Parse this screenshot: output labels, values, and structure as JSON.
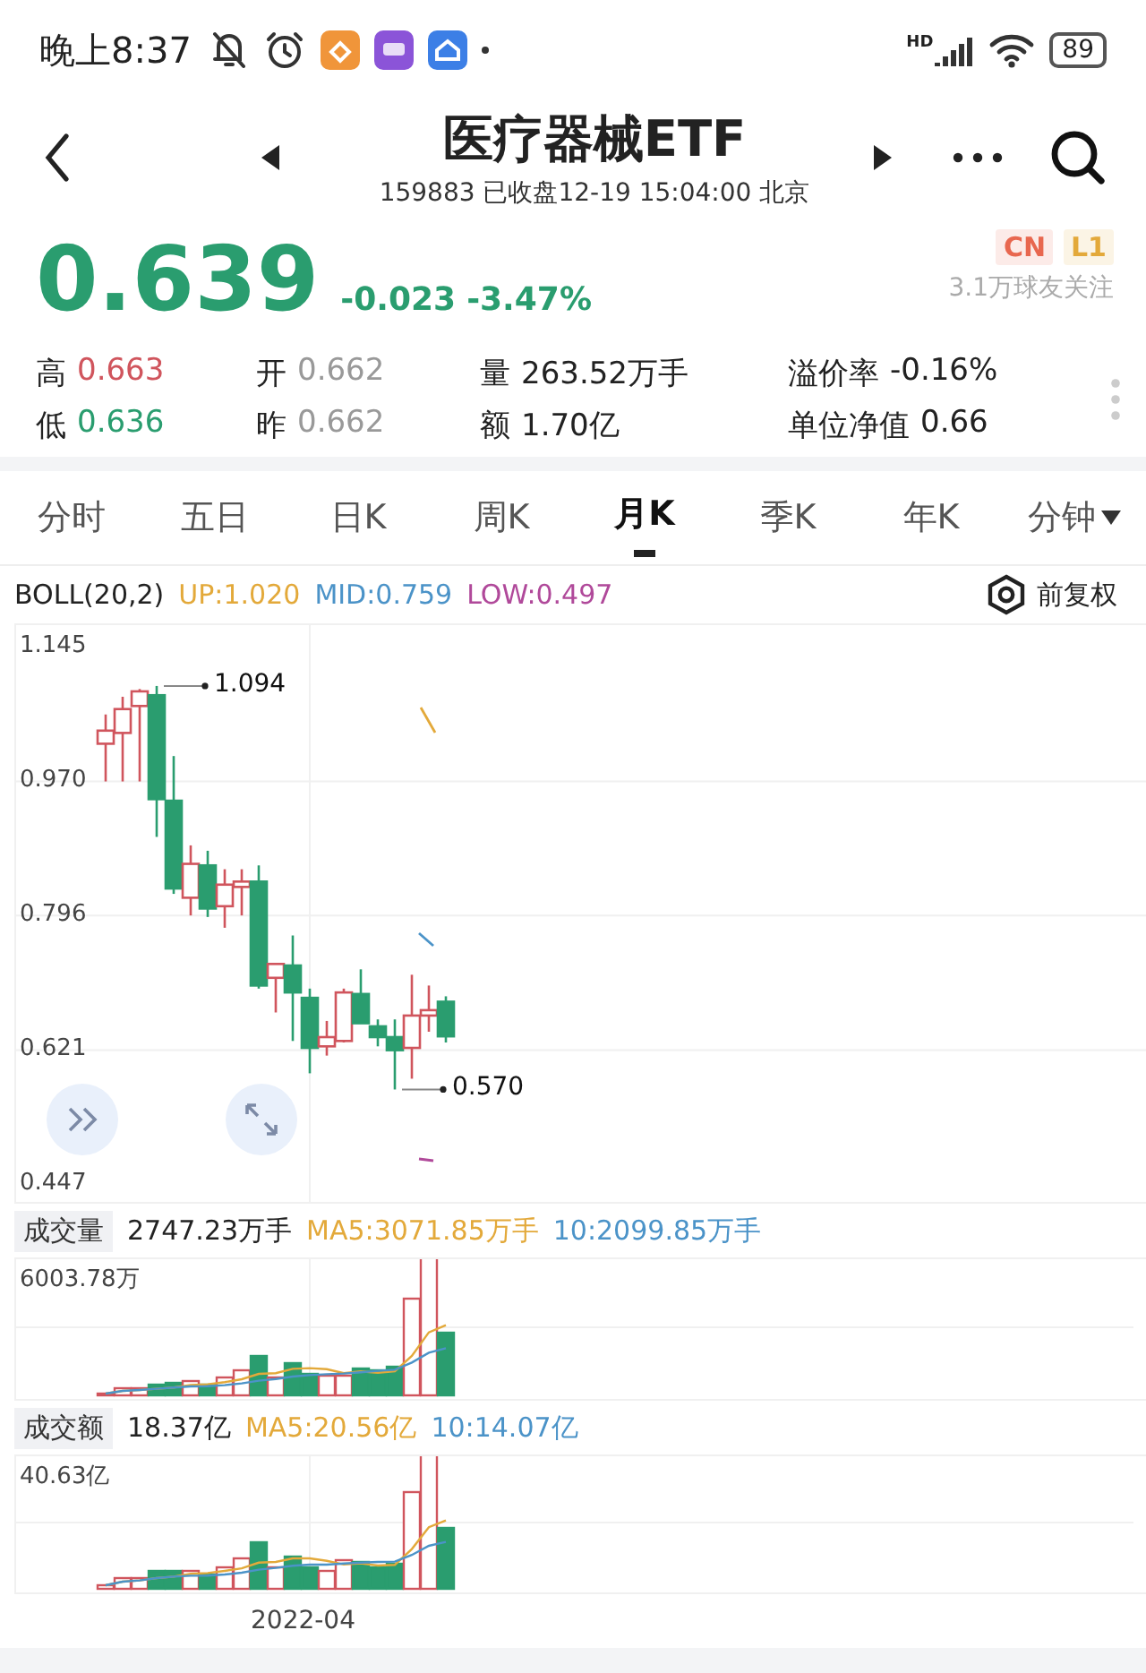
{
  "status_bar": {
    "time": "晚上8:37",
    "network": "HD",
    "battery": "89"
  },
  "header": {
    "title": "医疗器械ETF",
    "subtitle": "159883 已收盘12-19 15:04:00 北京"
  },
  "quote": {
    "price": "0.639",
    "change": "-0.023",
    "change_pct": "-3.47%",
    "kind": "down",
    "followers": "3.1万球友关注",
    "badges": [
      {
        "label": "CN",
        "color": "#e8674f"
      },
      {
        "label": "L1",
        "color": "#e3a93a"
      }
    ]
  },
  "stats": [
    {
      "label": "高",
      "value": "0.663",
      "kind": "up"
    },
    {
      "label": "开",
      "value": "0.662",
      "kind": "flat"
    },
    {
      "label": "量",
      "value": "263.52万手",
      "kind": "plain"
    },
    {
      "label": "溢价率",
      "value": "-0.16%",
      "kind": "plain"
    },
    {
      "label": "低",
      "value": "0.636",
      "kind": "down"
    },
    {
      "label": "昨",
      "value": "0.662",
      "kind": "flat"
    },
    {
      "label": "额",
      "value": "1.70亿",
      "kind": "plain"
    },
    {
      "label": "单位净值",
      "value": "0.66",
      "kind": "plain"
    }
  ],
  "tabs": [
    {
      "label": "分时",
      "selected": false,
      "dropdown": false
    },
    {
      "label": "五日",
      "selected": false,
      "dropdown": false
    },
    {
      "label": "日K",
      "selected": false,
      "dropdown": false
    },
    {
      "label": "周K",
      "selected": false,
      "dropdown": false
    },
    {
      "label": "月K",
      "selected": true,
      "dropdown": false
    },
    {
      "label": "季K",
      "selected": false,
      "dropdown": false
    },
    {
      "label": "年K",
      "selected": false,
      "dropdown": false
    },
    {
      "label": "分钟",
      "selected": false,
      "dropdown": true
    }
  ],
  "indicator": {
    "name": "BOLL(20,2)",
    "adjust": "前复权",
    "values": [
      {
        "text": "UP:1.020",
        "color": "#e3a93a"
      },
      {
        "text": "MID:0.759",
        "color": "#4b93c8"
      },
      {
        "text": "LOW:0.497",
        "color": "#b0499a"
      }
    ]
  },
  "price_chart": {
    "chart_data": {
      "type": "candlestick",
      "ylim": [
        0.424,
        1.173
      ],
      "yticks": [
        {
          "value": 1.145,
          "label": "1.145"
        },
        {
          "value": 0.97,
          "label": "0.970"
        },
        {
          "value": 0.796,
          "label": "0.796"
        },
        {
          "value": 0.621,
          "label": "0.621"
        },
        {
          "value": 0.447,
          "label": "0.447"
        }
      ],
      "grid": true,
      "ohlc": [
        [
          1.019,
          1.057,
          0.97,
          1.036
        ],
        [
          1.033,
          1.08,
          0.97,
          1.064
        ],
        [
          1.068,
          1.09,
          0.97,
          1.087
        ],
        [
          1.082,
          1.094,
          0.898,
          0.947
        ],
        [
          0.945,
          1.003,
          0.824,
          0.831
        ],
        [
          0.819,
          0.887,
          0.796,
          0.863
        ],
        [
          0.861,
          0.88,
          0.794,
          0.805
        ],
        [
          0.808,
          0.856,
          0.78,
          0.836
        ],
        [
          0.833,
          0.856,
          0.796,
          0.84
        ],
        [
          0.84,
          0.861,
          0.701,
          0.705
        ],
        [
          0.715,
          0.733,
          0.67,
          0.733
        ],
        [
          0.731,
          0.77,
          0.633,
          0.696
        ],
        [
          0.689,
          0.701,
          0.591,
          0.624
        ],
        [
          0.626,
          0.659,
          0.614,
          0.638
        ],
        [
          0.633,
          0.701,
          0.631,
          0.696
        ],
        [
          0.694,
          0.726,
          0.656,
          0.656
        ],
        [
          0.652,
          0.661,
          0.626,
          0.638
        ],
        [
          0.638,
          0.661,
          0.57,
          0.621
        ],
        [
          0.624,
          0.719,
          0.584,
          0.666
        ],
        [
          0.666,
          0.705,
          0.645,
          0.673
        ],
        [
          0.684,
          0.691,
          0.631,
          0.639
        ]
      ],
      "annotations": [
        "1.094",
        "0.570"
      ]
    }
  },
  "volume": {
    "title": "成交量",
    "value": "2747.23万手",
    "max_label": "6003.78万",
    "averages": [
      {
        "text": "MA5:3071.85万手",
        "color": "#e3a93a"
      },
      {
        "text": "10:2099.85万手",
        "color": "#4b93c8"
      }
    ]
  },
  "amount": {
    "title": "成交额",
    "value": "18.37亿",
    "max_label": "40.63亿",
    "averages": [
      {
        "text": "MA5:20.56亿",
        "color": "#e3a93a"
      },
      {
        "text": "10:14.07亿",
        "color": "#4b93c8"
      }
    ]
  },
  "x_label": "2022-04"
}
